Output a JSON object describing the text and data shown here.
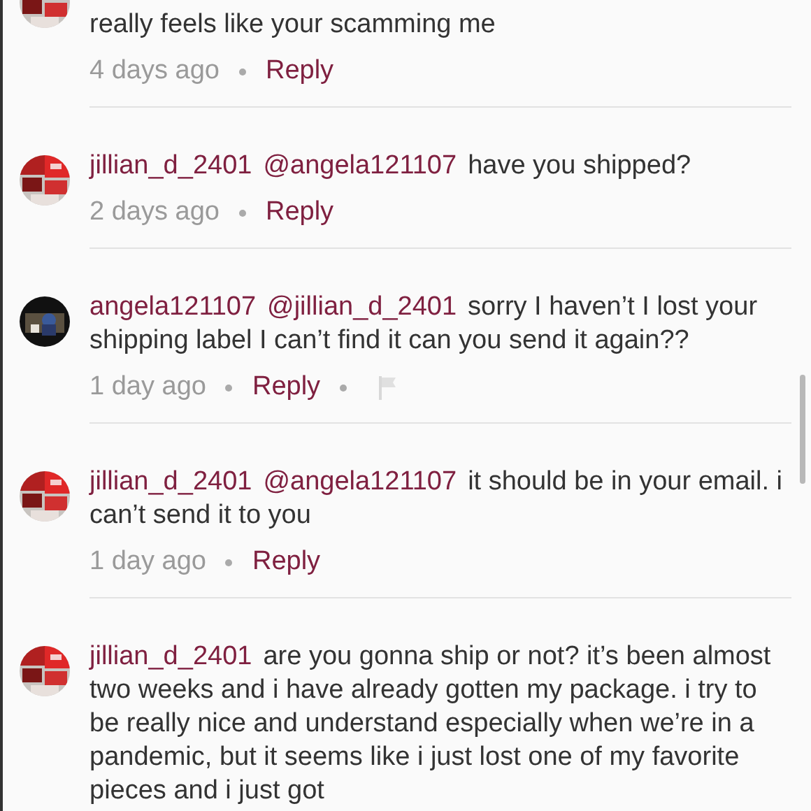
{
  "comments": [
    {
      "body": "really feels like your scamming me",
      "time": "4 days ago",
      "reply": "Reply",
      "flag": false
    },
    {
      "username": "jillian_d_2401",
      "mention": "@angela121107",
      "body": "have you shipped?",
      "time": "2 days ago",
      "reply": "Reply",
      "flag": false
    },
    {
      "username": "angela121107",
      "mention": "@jillian_d_2401",
      "body": "sorry I haven’t I lost your shipping label I can’t find it can you send it again??",
      "time": "1 day ago",
      "reply": "Reply",
      "flag": true
    },
    {
      "username": "jillian_d_2401",
      "mention": "@angela121107",
      "body": "it should be in your email. i can’t send it to you",
      "time": "1 day ago",
      "reply": "Reply",
      "flag": false
    },
    {
      "username": "jillian_d_2401",
      "body": "are you gonna ship or not? it’s been almost two weeks and i have already gotten my package. i try to be really nice and understand especially when we’re in a pandemic, but it seems like i just lost one of my favorite pieces and i just got"
    }
  ]
}
